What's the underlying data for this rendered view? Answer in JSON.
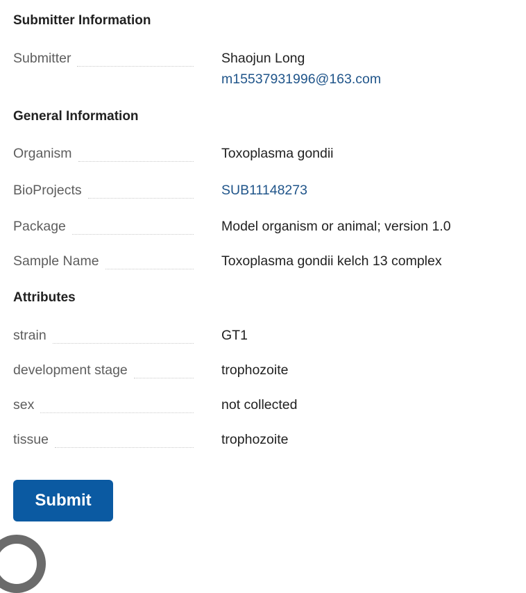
{
  "sections": {
    "submitter": {
      "title": "Submitter Information",
      "submitter_label": "Submitter",
      "submitter_name": "Shaojun Long",
      "submitter_email": "m15537931996@163.com"
    },
    "general": {
      "title": "General Information",
      "rows": [
        {
          "label": "Organism",
          "value": "Toxoplasma gondii"
        },
        {
          "label": "BioProjects",
          "value": "SUB11148273"
        },
        {
          "label": "Package",
          "value": "Model organism or animal; version 1.0"
        },
        {
          "label": "Sample Name",
          "value": "Toxoplasma gondii kelch 13 complex"
        }
      ]
    },
    "attributes": {
      "title": "Attributes",
      "rows": [
        {
          "label": "strain",
          "value": "GT1"
        },
        {
          "label": "development stage",
          "value": "trophozoite"
        },
        {
          "label": "sex",
          "value": "not collected"
        },
        {
          "label": "tissue",
          "value": "trophozoite"
        }
      ]
    }
  },
  "actions": {
    "submit_label": "Submit"
  },
  "colors": {
    "link": "#20558a",
    "button": "#0b5aa2",
    "label": "#5d5d5d",
    "text": "#212121"
  }
}
